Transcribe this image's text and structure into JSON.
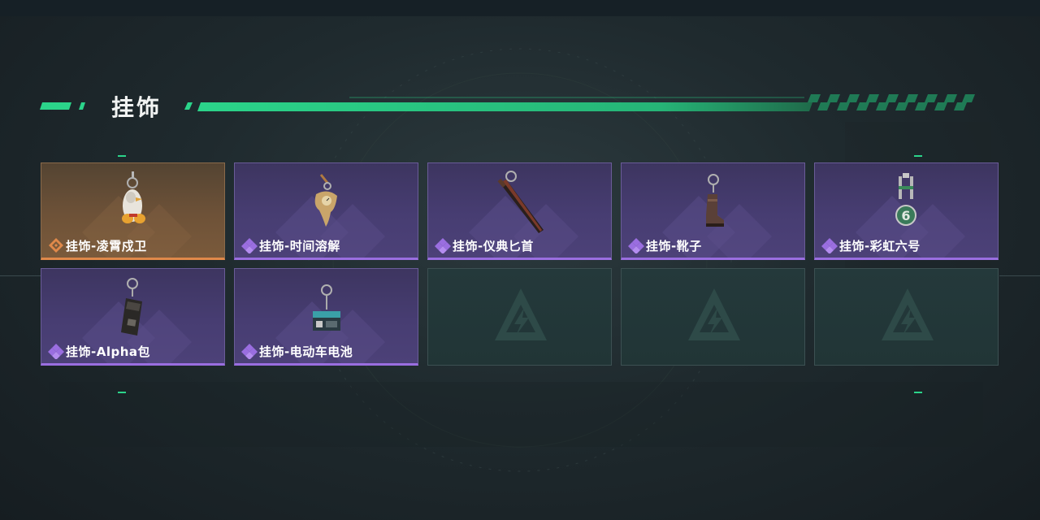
{
  "section": {
    "title": "挂饰"
  },
  "colors": {
    "accent": "#2bd48a",
    "epic": "#9a6ee0",
    "legendary": "#e0894a",
    "empty_slot": "#24393b"
  },
  "items": [
    {
      "label": "挂饰-凌霄戍卫",
      "rarity": "legendary",
      "icon": "chicken-charm-icon"
    },
    {
      "label": "挂饰-时间溶解",
      "rarity": "epic",
      "icon": "melting-clock-charm-icon"
    },
    {
      "label": "挂饰-仪典匕首",
      "rarity": "epic",
      "icon": "dagger-charm-icon"
    },
    {
      "label": "挂饰-靴子",
      "rarity": "epic",
      "icon": "boot-charm-icon"
    },
    {
      "label": "挂饰-彩虹六号",
      "rarity": "epic",
      "icon": "rainbow-six-charm-icon"
    },
    {
      "label": "挂饰-Alpha包",
      "rarity": "epic",
      "icon": "pouch-charm-icon"
    },
    {
      "label": "挂饰-电动车电池",
      "rarity": "epic",
      "icon": "battery-charm-icon"
    }
  ],
  "empty_slots": 3
}
